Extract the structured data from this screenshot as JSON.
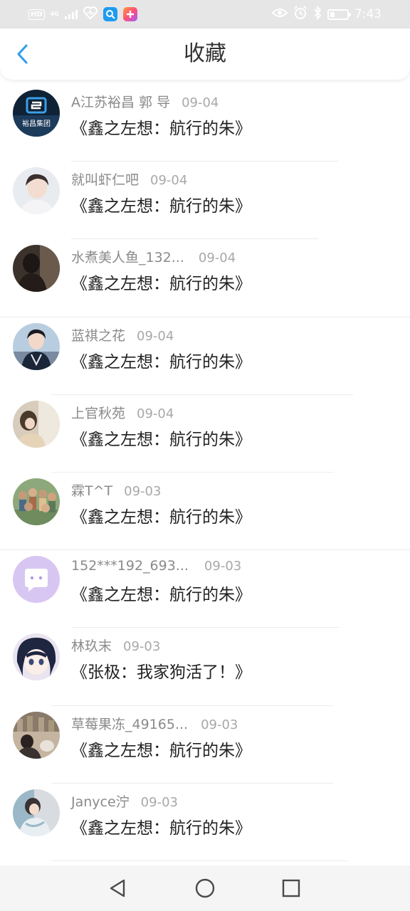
{
  "status_bar": {
    "hd_badge": "HD",
    "network_top": "4G",
    "network_bottom": "4G",
    "time": "7:43",
    "icons": [
      "hd-badge",
      "signal-icon",
      "heart-app-icon",
      "search-app-icon",
      "plus-app-icon",
      "eye-icon",
      "alarm-icon",
      "bluetooth-icon",
      "battery-icon"
    ],
    "app_colors": {
      "search_app": "#1e9bf0",
      "plus_app": "#ff5a4f"
    }
  },
  "header": {
    "title": "收藏",
    "back_icon": "chevron-left-icon",
    "accent_color": "#2c9fe8"
  },
  "items": [
    {
      "name": "A江苏裕昌 郭 导",
      "date": "09-04",
      "title": "《鑫之左想：航行的朱》",
      "avatar_text": "裕昌集团",
      "avatar_colors": [
        "#0f2236",
        "#1c3a5a"
      ]
    },
    {
      "name": "就叫虾仁吧",
      "date": "09-04",
      "title": "《鑫之左想：航行的朱》",
      "avatar_colors": [
        "#e8ecf0",
        "#3a3030"
      ]
    },
    {
      "name": "水煮美人鱼_132...",
      "date": "09-04",
      "title": "《鑫之左想：航行的朱》",
      "avatar_colors": [
        "#3b322c",
        "#6a5a4c"
      ]
    },
    {
      "name": "蓝祺之花",
      "date": "09-04",
      "title": "《鑫之左想：航行的朱》",
      "avatar_colors": [
        "#b9cde0",
        "#1a2538"
      ]
    },
    {
      "name": "上官秋苑",
      "date": "09-04",
      "title": "《鑫之左想：航行的朱》",
      "avatar_colors": [
        "#d8cdbc",
        "#4a3a2c"
      ]
    },
    {
      "name": "霖T^T",
      "date": "09-03",
      "title": "《鑫之左想：航行的朱》",
      "avatar_colors": [
        "#8da87a",
        "#c49a7a"
      ]
    },
    {
      "name": "152***192_693...",
      "date": "09-03",
      "title": "《鑫之左想：航行的朱》",
      "avatar_colors": [
        "#d8c6f2",
        "#ffffff"
      ]
    },
    {
      "name": "林玖末",
      "date": "09-03",
      "title": "《张极：我家狗活了！》",
      "avatar_colors": [
        "#1e2640",
        "#eae3f0"
      ]
    },
    {
      "name": "草莓果冻_49165...",
      "date": "09-03",
      "title": "《鑫之左想：航行的朱》",
      "avatar_colors": [
        "#8a7a6a",
        "#c4b4a0"
      ]
    },
    {
      "name": "Janyce泞",
      "date": "09-03",
      "title": "《鑫之左想：航行的朱》",
      "avatar_colors": [
        "#9bb8c8",
        "#d8dce0"
      ]
    }
  ],
  "nav_bar": {
    "back_icon": "triangle-back-icon",
    "home_icon": "circle-home-icon",
    "recents_icon": "square-recents-icon"
  }
}
